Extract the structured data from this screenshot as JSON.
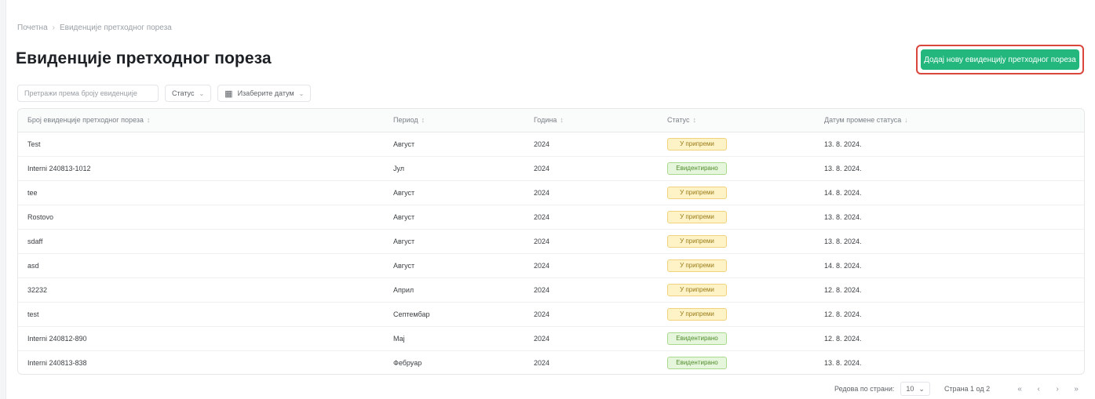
{
  "breadcrumb": {
    "home": "Почетна",
    "current": "Евиденције претходног пореза"
  },
  "page": {
    "title": "Евиденције претходног пореза"
  },
  "actions": {
    "add_button": "Додај нову евиденцију претходног пореза"
  },
  "filters": {
    "search_placeholder": "Претражи према броју евиденције",
    "status_label": "Статус",
    "date_label": "Изаберите датум"
  },
  "table": {
    "headers": {
      "number": "Број евиденције претходног пореза",
      "period": "Период",
      "year": "Година",
      "status": "Статус",
      "changed": "Датум промене статуса"
    },
    "rows": [
      {
        "number": "Test",
        "period": "Август",
        "year": "2024",
        "status": "У припреми",
        "status_type": "pending",
        "changed": "13. 8. 2024."
      },
      {
        "number": "Interni 240813-1012",
        "period": "Јул",
        "year": "2024",
        "status": "Евидентирано",
        "status_type": "done",
        "changed": "13. 8. 2024."
      },
      {
        "number": "tee",
        "period": "Август",
        "year": "2024",
        "status": "У припреми",
        "status_type": "pending",
        "changed": "14. 8. 2024."
      },
      {
        "number": "Rostovo",
        "period": "Август",
        "year": "2024",
        "status": "У припреми",
        "status_type": "pending",
        "changed": "13. 8. 2024."
      },
      {
        "number": "sdaff",
        "period": "Август",
        "year": "2024",
        "status": "У припреми",
        "status_type": "pending",
        "changed": "13. 8. 2024."
      },
      {
        "number": "asd",
        "period": "Август",
        "year": "2024",
        "status": "У припреми",
        "status_type": "pending",
        "changed": "14. 8. 2024."
      },
      {
        "number": "32232",
        "period": "Април",
        "year": "2024",
        "status": "У припреми",
        "status_type": "pending",
        "changed": "12. 8. 2024."
      },
      {
        "number": "test",
        "period": "Септембар",
        "year": "2024",
        "status": "У припреми",
        "status_type": "pending",
        "changed": "12. 8. 2024."
      },
      {
        "number": "Interni 240812-890",
        "period": "Мај",
        "year": "2024",
        "status": "Евидентирано",
        "status_type": "done",
        "changed": "12. 8. 2024."
      },
      {
        "number": "Interni 240813-838",
        "period": "Фебруар",
        "year": "2024",
        "status": "Евидентирано",
        "status_type": "done",
        "changed": "13. 8. 2024."
      }
    ]
  },
  "pagination": {
    "rows_label": "Редова по страни:",
    "rows_value": "10",
    "page_info": "Страна 1 од 2"
  },
  "colors": {
    "primary": "#23b77e",
    "highlight": "#d9463c",
    "pending": "#fdf3c7",
    "done": "#e6f6dd"
  }
}
